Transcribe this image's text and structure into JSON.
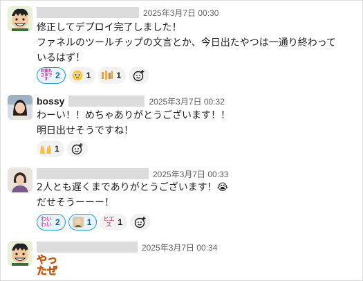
{
  "messages": [
    {
      "sender": "",
      "timestamp": "2025年3月7日 00:30",
      "lines": [
        "修正してデプロイ完了しました！",
        "ファネルのツールチップの文言とか、今日出たやつは一通り終わって",
        "いるはず！"
      ],
      "reactions": [
        {
          "emoji": "お疲れさまです",
          "count": "2",
          "active": true
        },
        {
          "emoji": "pleading-face",
          "count": "1",
          "active": false
        },
        {
          "emoji": "clap-sticker",
          "count": "1",
          "active": false
        }
      ]
    },
    {
      "sender": "bossy",
      "timestamp": "2025年3月7日 00:32",
      "lines": [
        "わーい！！めちゃありがとうございます！！",
        "明日出せそうですね！"
      ],
      "reactions": [
        {
          "emoji": "raised-hands",
          "count": "1",
          "active": false
        }
      ]
    },
    {
      "sender": "",
      "timestamp": "2025年3月7日 00:33",
      "lines": [
        "2人とも遅くまでありがとうございます！😭",
        "だせそうーーー！"
      ],
      "reactions": [
        {
          "emoji": "わいわい",
          "count": "2",
          "active": true
        },
        {
          "emoji": "sticker-person",
          "count": "1",
          "active": true
        },
        {
          "emoji": "ヒエス",
          "count": "1",
          "active": false
        }
      ]
    },
    {
      "sender": "",
      "timestamp": "2025年3月7日 00:34",
      "sticker_text": [
        "やっ",
        "たぜ"
      ]
    }
  ],
  "icons": {
    "add_reaction": "add-reaction-icon"
  },
  "colors": {
    "accent": "#1264a3",
    "active_reaction_bg": "#e8f3fb",
    "active_reaction_border": "#1d9bd1",
    "sticker_orange": "#f07c1b"
  }
}
